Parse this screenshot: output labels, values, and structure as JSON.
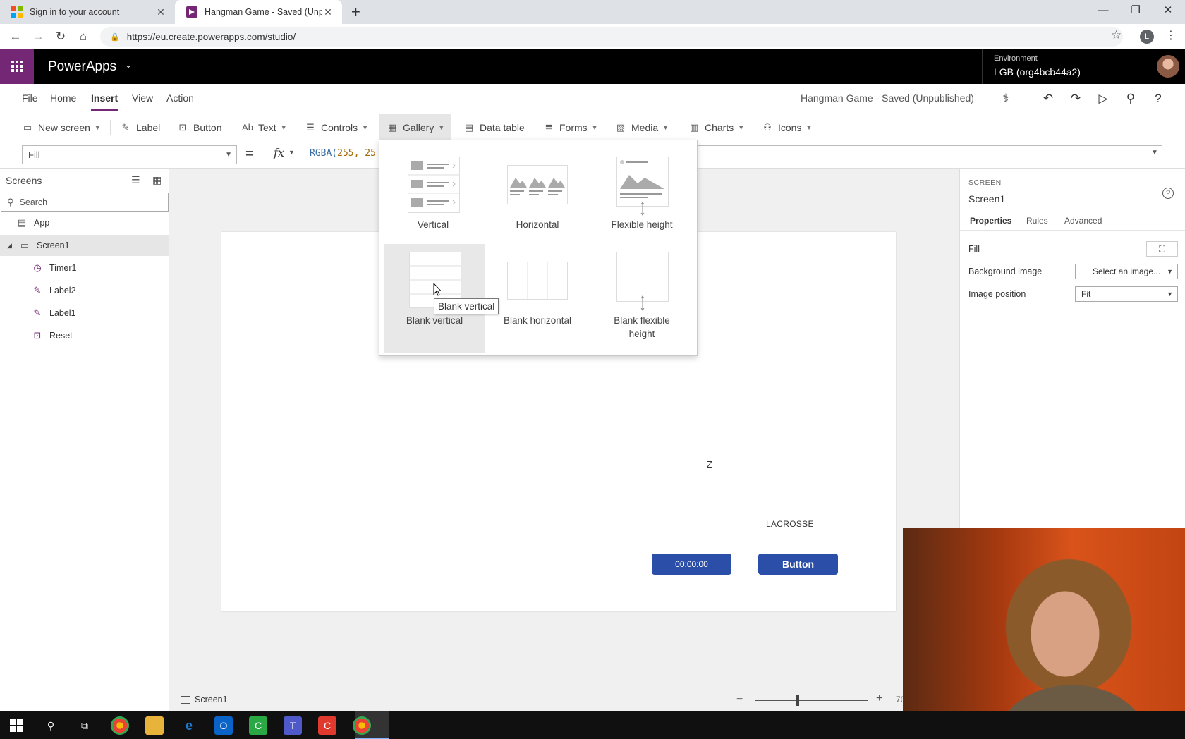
{
  "browser": {
    "tabs": [
      {
        "title": "Sign in to your account"
      },
      {
        "title": "Hangman Game - Saved (Unpubl"
      }
    ],
    "url": "https://eu.create.powerapps.com/studio/",
    "profile_initial": "L"
  },
  "app": {
    "name": "PowerApps",
    "environment_label": "Environment",
    "environment_value": "LGB (org4bcb44a2)",
    "doc_status": "Hangman Game - Saved (Unpublished)",
    "accent": "#742774"
  },
  "menu": {
    "tabs": [
      "File",
      "Home",
      "Insert",
      "View",
      "Action"
    ],
    "active": "Insert"
  },
  "ribbon": {
    "new_screen": "New screen",
    "label": "Label",
    "button": "Button",
    "text": "Text",
    "controls": "Controls",
    "gallery": "Gallery",
    "data_table": "Data table",
    "forms": "Forms",
    "media": "Media",
    "charts": "Charts",
    "icons": "Icons"
  },
  "formula": {
    "property": "Fill",
    "equals": "=",
    "fx": "fx",
    "func": "RGBA(",
    "args": "255, 25"
  },
  "screens_panel": {
    "title": "Screens",
    "search_placeholder": "Search",
    "items": [
      {
        "label": "App",
        "icon": "app-icon"
      },
      {
        "label": "Screen1",
        "icon": "screen-icon"
      },
      {
        "label": "Timer1",
        "icon": "timer-icon"
      },
      {
        "label": "Label2",
        "icon": "edit-label-icon"
      },
      {
        "label": "Label1",
        "icon": "edit-label-icon"
      },
      {
        "label": "Reset",
        "icon": "button-icon"
      }
    ]
  },
  "gallery_menu": {
    "items": [
      "Vertical",
      "Horizontal",
      "Flexible height",
      "Blank vertical",
      "Blank horizontal",
      "Blank flexible height"
    ],
    "blank_flex_line1": "Blank flexible",
    "blank_flex_line2": "height",
    "tooltip": "Blank vertical"
  },
  "canvas": {
    "letter": "Z",
    "word": "LACROSSE",
    "timer_text": "00:00:00",
    "button_text": "Button",
    "button_color": "#2b4ea8"
  },
  "properties_panel": {
    "kind": "SCREEN",
    "name": "Screen1",
    "tabs": [
      "Properties",
      "Rules",
      "Advanced"
    ],
    "fill_label": "Fill",
    "bg_image_label": "Background image",
    "bg_image_value": "Select an image...",
    "image_position_label": "Image position",
    "image_position_value": "Fit"
  },
  "status_bar": {
    "screen": "Screen1",
    "zoom": "70",
    "zoom_level": 0.38
  }
}
